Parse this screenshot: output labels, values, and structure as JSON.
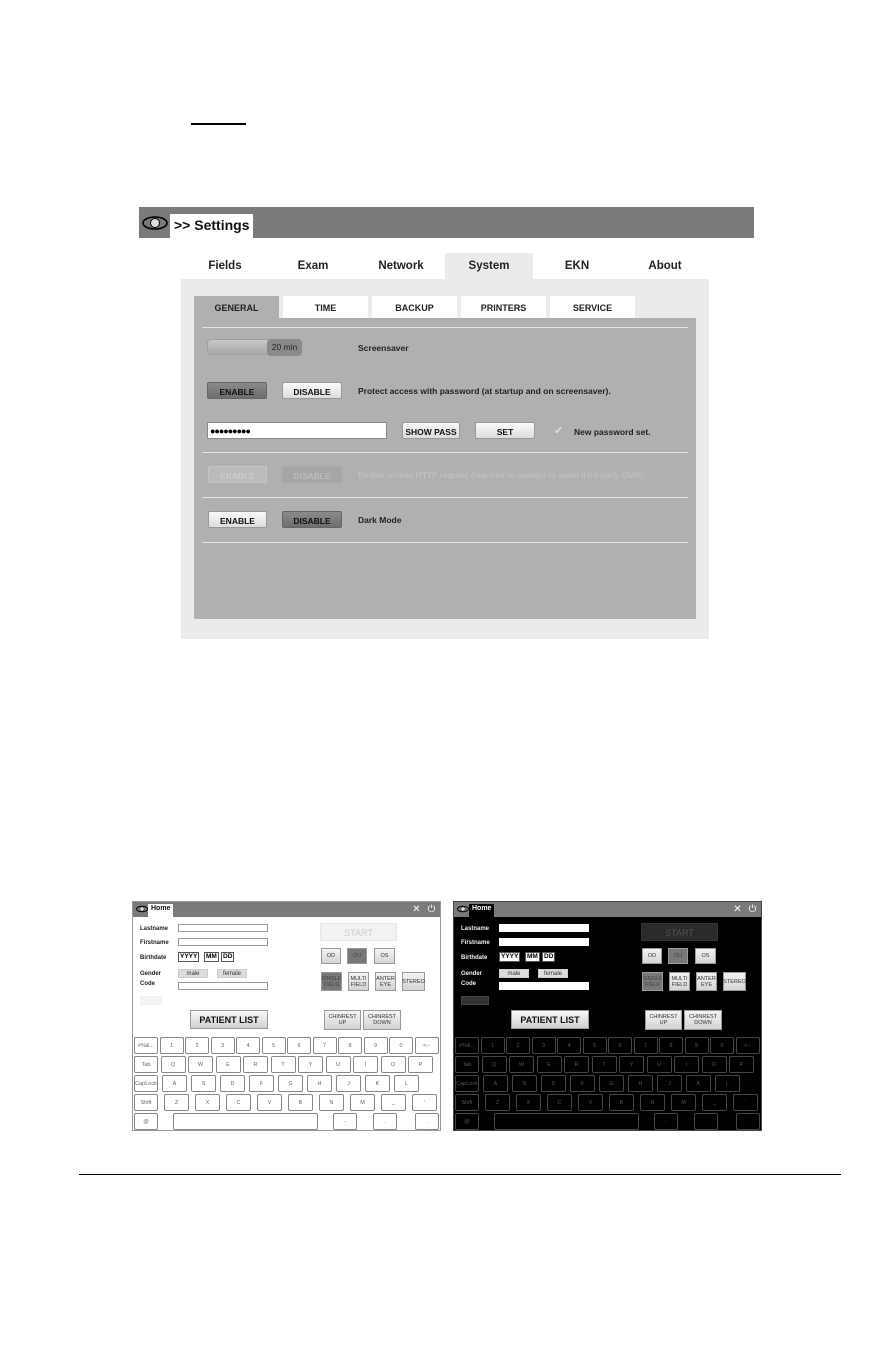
{
  "settings": {
    "breadcrumb": {
      "home": "Home",
      "separator": " >> ",
      "current": "Settings"
    },
    "top_tabs": [
      {
        "label": "Fields",
        "active": false
      },
      {
        "label": "Exam",
        "active": false
      },
      {
        "label": "Network",
        "active": false
      },
      {
        "label": "System",
        "active": true
      },
      {
        "label": "EKN",
        "active": false
      },
      {
        "label": "About",
        "active": false
      }
    ],
    "sub_tabs": [
      {
        "label": "GENERAL",
        "active": true
      },
      {
        "label": "TIME",
        "active": false
      },
      {
        "label": "BACKUP",
        "active": false
      },
      {
        "label": "PRINTERS",
        "active": false
      },
      {
        "label": "SERVICE",
        "active": false
      }
    ],
    "screensaver": {
      "value": "20 min",
      "label": "Screensaver"
    },
    "password_protect": {
      "enable": "ENABLE",
      "disable": "DISABLE",
      "selected": "ENABLE",
      "label": "Protect access with password (at startup and on screensaver).",
      "password_value": "●●●●●●●●●",
      "show_pass": "SHOW PASS",
      "set": "SET",
      "status": "New password set."
    },
    "remote_http": {
      "enable": "ENABLE",
      "disable": "DISABLE",
      "disabled": true,
      "label": "Enable remote HTTP request (required to connect to some third party EMR)."
    },
    "dark_mode": {
      "enable": "ENABLE",
      "disable": "DISABLE",
      "selected": "DISABLE",
      "label": "Dark Mode"
    }
  },
  "home_screens": [
    {
      "theme": "light",
      "tab": "Home",
      "fields": {
        "lastname": "Lastname",
        "firstname": "Firstname",
        "birthdate": "Birthdate",
        "gender": "Gender",
        "code": "Code"
      },
      "birthdate_placeholders": {
        "year": "YYYY",
        "month": "MM",
        "day": "DD"
      },
      "gender_options": [
        "male",
        "female"
      ],
      "start": "START",
      "eye_buttons": [
        "OD",
        "OU",
        "OS"
      ],
      "eye_selected": "OU",
      "mode_buttons": [
        "SINGLE FIELD",
        "MULTI FIELD",
        "ANTER EYE",
        "STEREO"
      ],
      "mode_selected": "SINGLE FIELD",
      "patient_list": "PATIENT LIST",
      "chinrest_up": "CHINREST UP",
      "chinrest_down": "CHINREST DOWN"
    },
    {
      "theme": "dark",
      "tab": "Home",
      "fields": {
        "lastname": "Lastname",
        "firstname": "Firstname",
        "birthdate": "Birthdate",
        "gender": "Gender",
        "code": "Code"
      },
      "birthdate_placeholders": {
        "year": "YYYY",
        "month": "MM",
        "day": "DD"
      },
      "gender_options": [
        "male",
        "female"
      ],
      "start": "START",
      "eye_buttons": [
        "OD",
        "OU",
        "OS"
      ],
      "eye_selected": "OU",
      "mode_buttons": [
        "SINGLE FIELD",
        "MULTI FIELD",
        "ANTER EYE",
        "STEREO"
      ],
      "mode_selected": "SINGLE FIELD",
      "patient_list": "PATIENT LIST",
      "chinrest_up": "CHINREST UP",
      "chinrest_down": "CHINREST DOWN"
    }
  ],
  "keyboard": {
    "rows": [
      [
        "#%&...",
        "1",
        "2",
        "3",
        "4",
        "5",
        "6",
        "7",
        "8",
        "9",
        "0",
        "<--"
      ],
      [
        "Tab",
        "Q",
        "W",
        "E",
        "R",
        "T",
        "Y",
        "U",
        "I",
        "O",
        "P"
      ],
      [
        "CapLock",
        "A",
        "S",
        "D",
        "F",
        "G",
        "H",
        "J",
        "K",
        "L"
      ],
      [
        "Shift",
        "Z",
        "X",
        "C",
        "V",
        "B",
        "N",
        "M",
        "_",
        "'"
      ],
      [
        "@",
        "",
        "-",
        ".",
        "."
      ]
    ]
  }
}
